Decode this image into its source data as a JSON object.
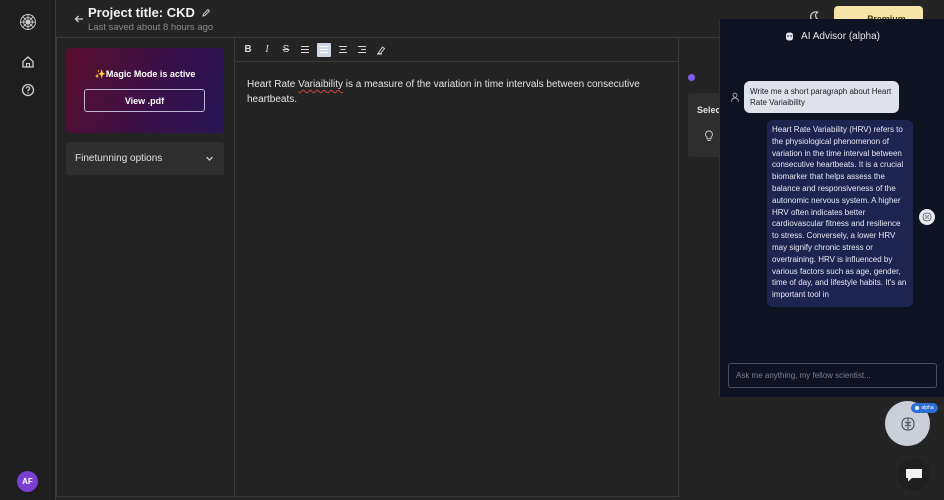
{
  "header": {
    "project_title": "Project title: CKD",
    "last_saved": "Last saved about 8 hours ago",
    "premium_label": "Premium"
  },
  "sidebar": {
    "avatar_initials": "AF"
  },
  "left_panel": {
    "magic_mode_text": "✨Magic Mode is active",
    "view_pdf_label": "View .pdf",
    "finetuning_label": "Finetunning options"
  },
  "editor": {
    "content_before": "Heart Rate ",
    "content_spell": "Variaibility",
    "content_after": " is a measure of the variation in time intervals between consecutive heartbeats."
  },
  "right_panel": {
    "card_label": "Selec"
  },
  "advisor": {
    "title": "AI Advisor (alpha)",
    "user_message": "Write me a short paragraph about Heart Rate Variaibility",
    "ai_message": "Heart Rate Variability (HRV) refers to the physiological phenomenon of variation in the time interval between consecutive heartbeats. It is a crucial biomarker that helps assess the balance and responsiveness of the autonomic nervous system. A higher HRV often indicates better cardiovascular fitness and resilience to stress. Conversely, a lower HRV may signify chronic stress or overtraining. HRV is influenced by various factors such as age, gender, time of day, and lifestyle habits. It's an important tool in",
    "input_placeholder": "Ask me anything, my fellow scientist...",
    "badge_label": "alpha"
  },
  "colors": {
    "accent_purple": "#7d5cf0",
    "premium_bg": "#f6e3a8",
    "advisor_bg": "#0d1320",
    "ai_bubble": "#1e2450"
  },
  "icons": [
    "logo-icon",
    "home-icon",
    "help-icon",
    "back-arrow-icon",
    "pencil-icon",
    "moon-icon",
    "chevron-down-icon",
    "robot-icon",
    "user-icon",
    "chat-icon"
  ]
}
